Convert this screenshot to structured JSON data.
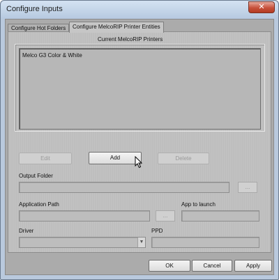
{
  "window": {
    "title": "Configure Inputs",
    "close_label": "✕"
  },
  "tabs": [
    {
      "label": "Configure Hot Folders"
    },
    {
      "label": "Configure MelcoRIP Printer Entities"
    }
  ],
  "printers_group": {
    "label": "Current MelcoRIP Printers",
    "items": [
      "Melco G3 Color & White"
    ]
  },
  "list_buttons": {
    "edit": "Edit",
    "add": "Add",
    "delete": "Delete"
  },
  "fields": {
    "output_folder": {
      "label": "Output Folder",
      "value": "",
      "browse": "..."
    },
    "application_path": {
      "label": "Application Path",
      "value": "",
      "browse": "..."
    },
    "app_to_launch": {
      "label": "App to launch",
      "value": ""
    },
    "driver": {
      "label": "Driver",
      "value": ""
    },
    "ppd": {
      "label": "PPD",
      "value": ""
    }
  },
  "dialog_buttons": {
    "ok": "OK",
    "cancel": "Cancel",
    "apply": "Apply"
  },
  "icons": {
    "dropdown": "chevron-down-icon",
    "cursor": "mouse-pointer-icon"
  }
}
